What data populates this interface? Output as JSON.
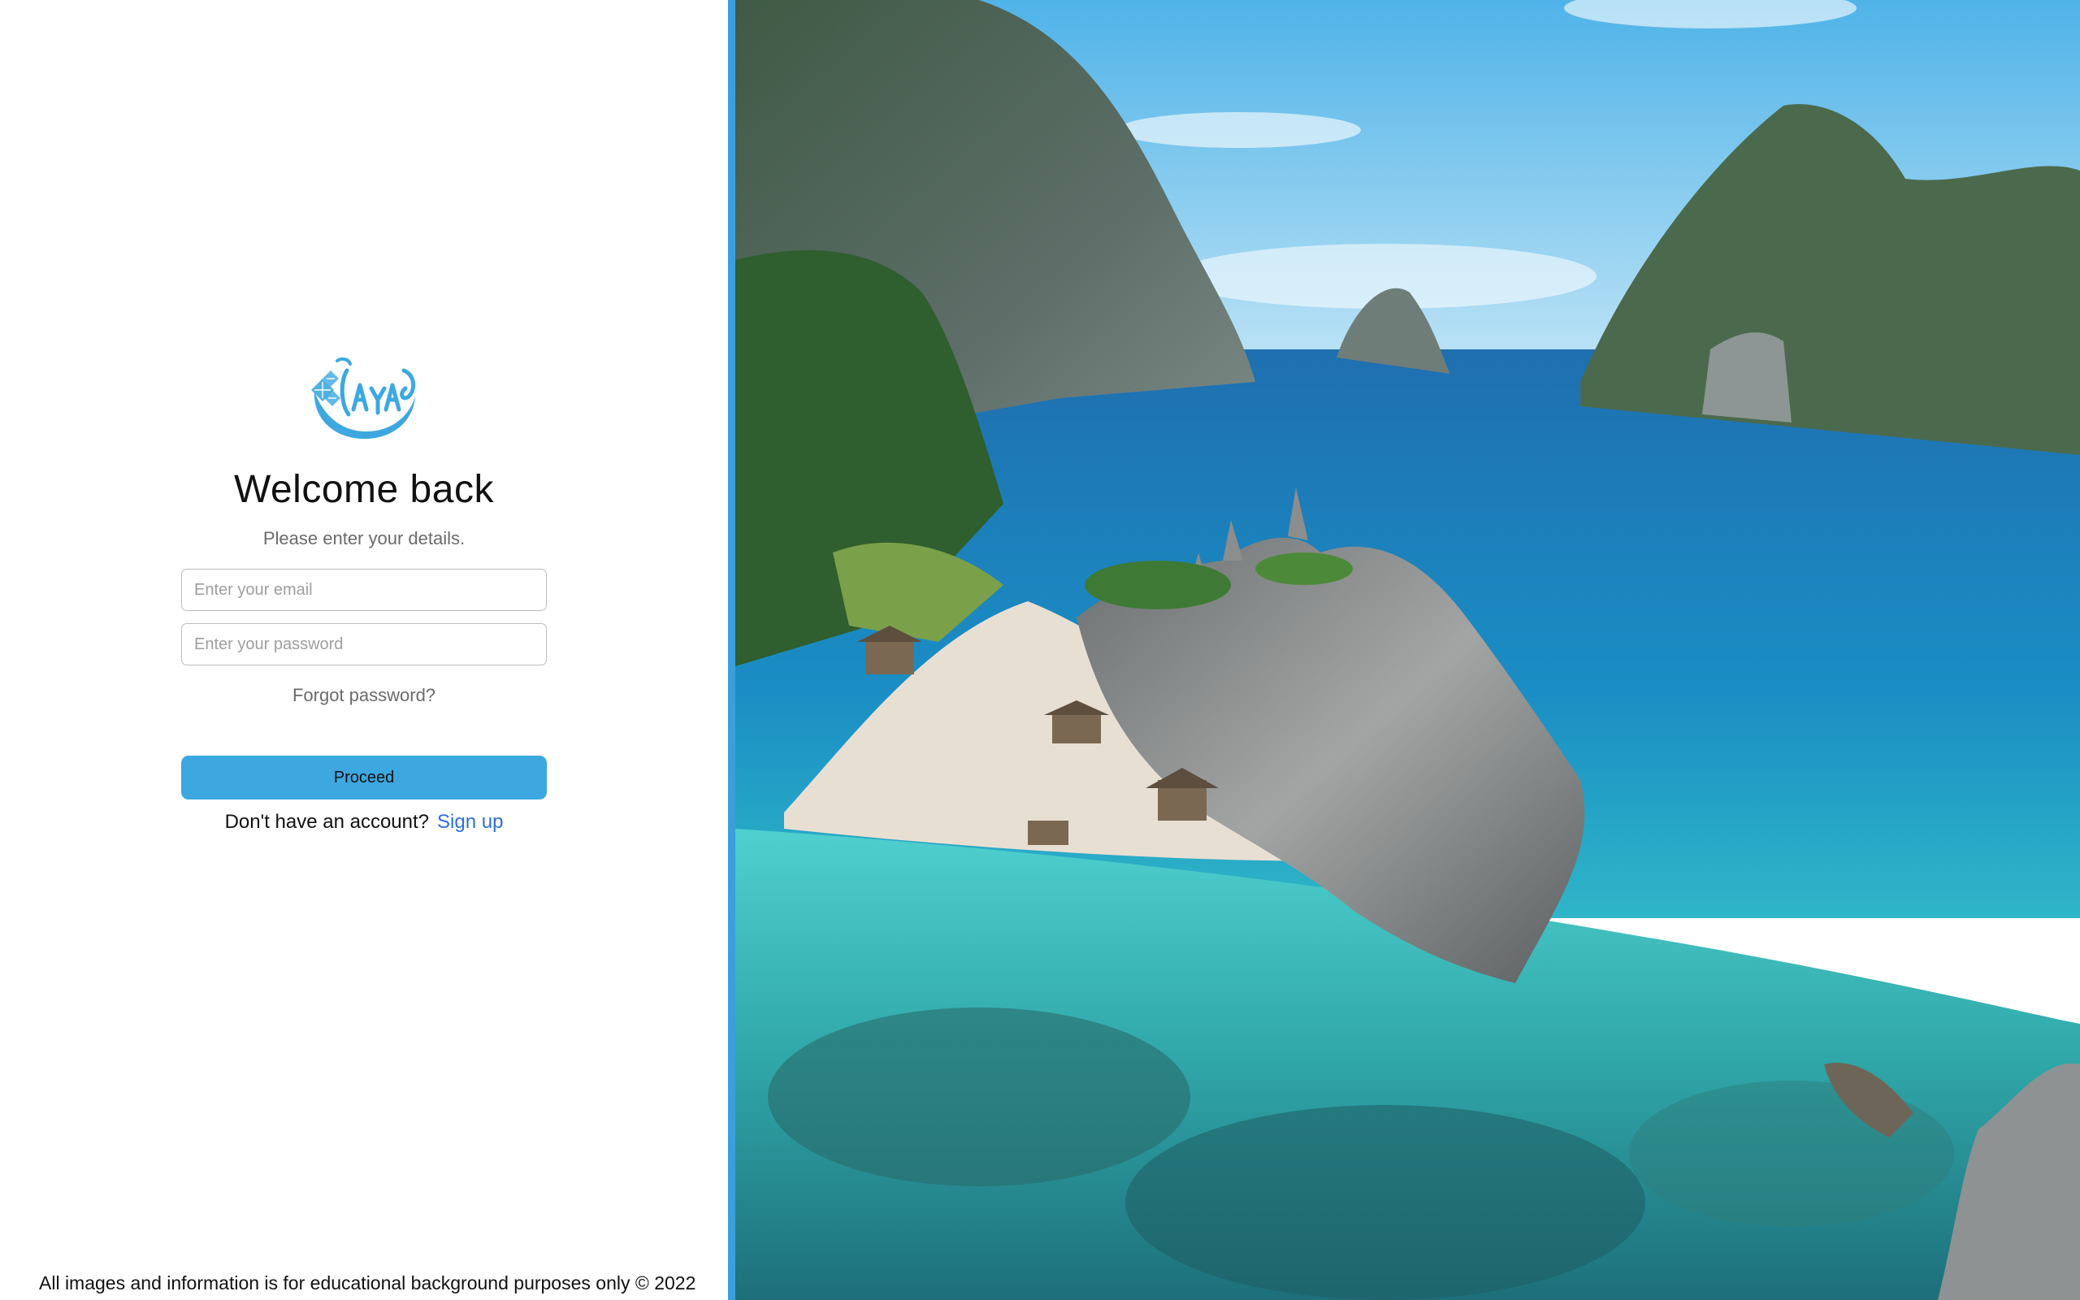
{
  "login": {
    "title": "Welcome back",
    "subtitle": "Please enter your details.",
    "email_placeholder": "Enter your email",
    "password_placeholder": "Enter your password",
    "forgot_label": "Forgot password?",
    "proceed_label": "Proceed",
    "no_account_text": "Don't have an account?",
    "signup_label": "Sign up"
  },
  "footer": {
    "text": "All images and information is for educational background purposes only © 2022"
  },
  "colors": {
    "accent": "#3da8e0",
    "divider": "#3a9fdb",
    "link": "#2f6fd6"
  },
  "icons": {
    "logo": "brand-logo-icon"
  }
}
